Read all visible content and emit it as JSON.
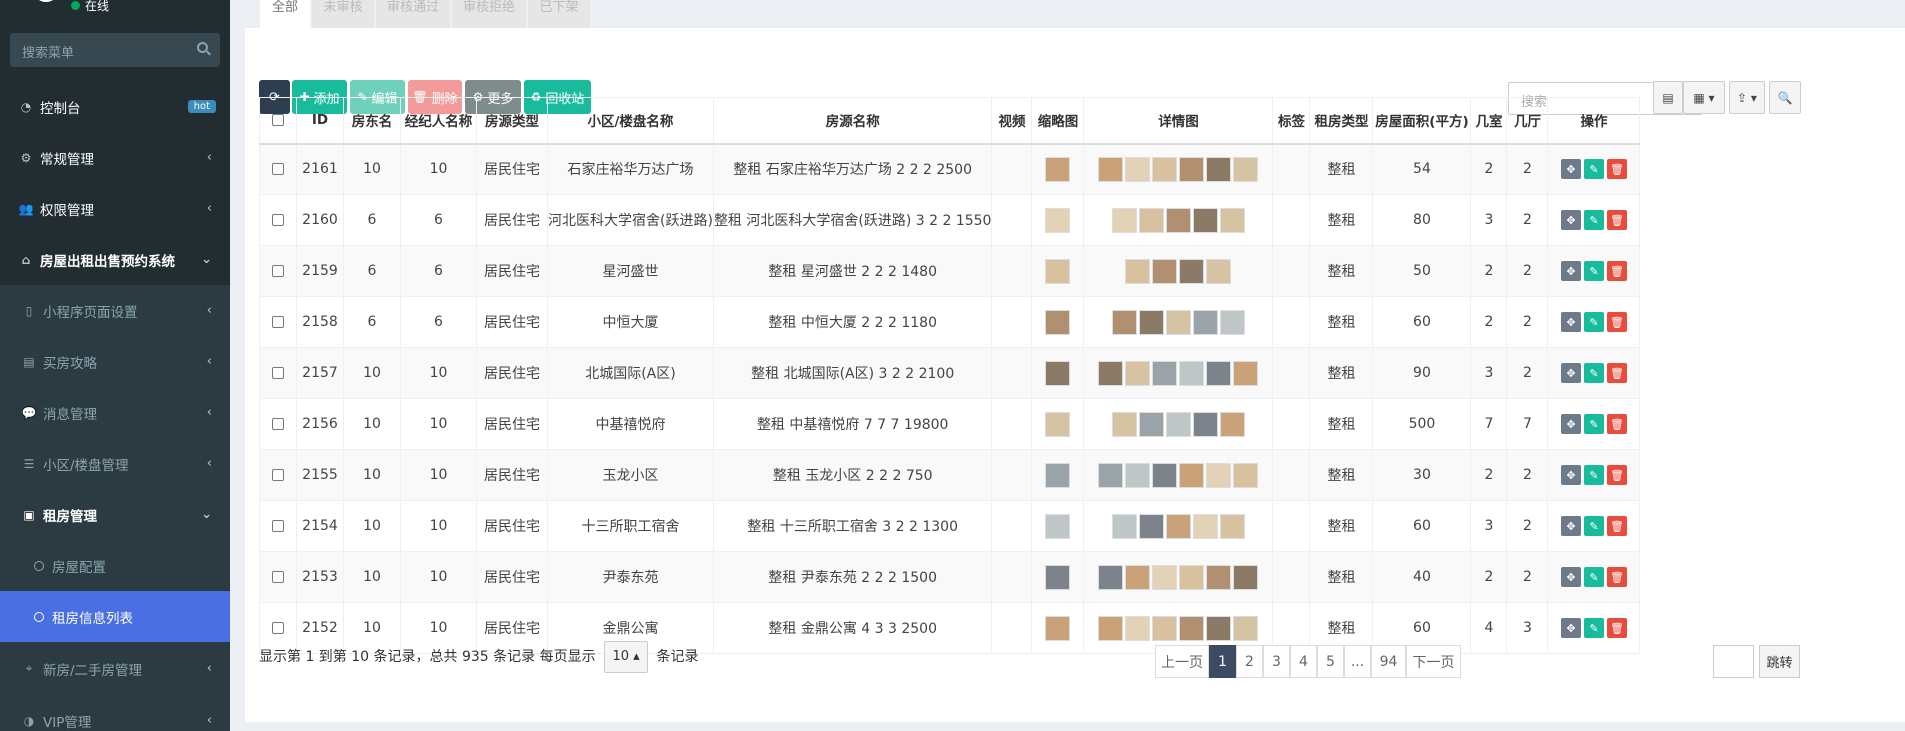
{
  "sidebar": {
    "status": "在线",
    "search_placeholder": "搜索菜单",
    "items": [
      {
        "label": "控制台",
        "badge": "hot"
      },
      {
        "label": "常规管理"
      },
      {
        "label": "权限管理"
      },
      {
        "label": "房屋出租出售预约系统"
      },
      {
        "label": "小程序页面设置"
      },
      {
        "label": "买房攻略"
      },
      {
        "label": "消息管理"
      },
      {
        "label": "小区/楼盘管理"
      },
      {
        "label": "租房管理"
      },
      {
        "label": "房屋配置"
      },
      {
        "label": "租房信息列表"
      },
      {
        "label": "新房/二手房管理"
      },
      {
        "label": "VIP管理"
      }
    ]
  },
  "tabs": [
    "全部",
    "未审核",
    "审核通过",
    "审核拒绝",
    "已下架"
  ],
  "toolbar": {
    "add": "添加",
    "edit": "编辑",
    "delete": "删除",
    "more": "更多",
    "recycle": "回收站",
    "search_placeholder": "搜索"
  },
  "columns": [
    "ID",
    "房东名",
    "经纪人名称",
    "房源类型",
    "小区/楼盘名称",
    "房源名称",
    "视频",
    "缩略图",
    "详情图",
    "标签",
    "租房类型",
    "房屋面积(平方)",
    "几室",
    "几厅",
    "操作"
  ],
  "rows": [
    {
      "id": "2161",
      "owner": "10",
      "agent": "10",
      "type": "居民住宅",
      "community": "石家庄裕华万达广场",
      "name": "整租 石家庄裕华万达广场 2 2 2 2500",
      "rent": "整租",
      "area": "54",
      "rooms": "2",
      "halls": "2",
      "imgs": 6
    },
    {
      "id": "2160",
      "owner": "6",
      "agent": "6",
      "type": "居民住宅",
      "community": "河北医科大学宿舍(跃进路)",
      "name": "整租 河北医科大学宿舍(跃进路) 3 2 2 1550",
      "rent": "整租",
      "area": "80",
      "rooms": "3",
      "halls": "2",
      "imgs": 5
    },
    {
      "id": "2159",
      "owner": "6",
      "agent": "6",
      "type": "居民住宅",
      "community": "星河盛世",
      "name": "整租 星河盛世 2 2 2 1480",
      "rent": "整租",
      "area": "50",
      "rooms": "2",
      "halls": "2",
      "imgs": 4
    },
    {
      "id": "2158",
      "owner": "6",
      "agent": "6",
      "type": "居民住宅",
      "community": "中恒大厦",
      "name": "整租 中恒大厦 2 2 2 1180",
      "rent": "整租",
      "area": "60",
      "rooms": "2",
      "halls": "2",
      "imgs": 5
    },
    {
      "id": "2157",
      "owner": "10",
      "agent": "10",
      "type": "居民住宅",
      "community": "北城国际(A区)",
      "name": "整租 北城国际(A区) 3 2 2 2100",
      "rent": "整租",
      "area": "90",
      "rooms": "3",
      "halls": "2",
      "imgs": 6
    },
    {
      "id": "2156",
      "owner": "10",
      "agent": "10",
      "type": "居民住宅",
      "community": "中基禧悦府",
      "name": "整租 中基禧悦府 7 7 7 19800",
      "rent": "整租",
      "area": "500",
      "rooms": "7",
      "halls": "7",
      "imgs": 5
    },
    {
      "id": "2155",
      "owner": "10",
      "agent": "10",
      "type": "居民住宅",
      "community": "玉龙小区",
      "name": "整租 玉龙小区 2 2 2 750",
      "rent": "整租",
      "area": "30",
      "rooms": "2",
      "halls": "2",
      "imgs": 6
    },
    {
      "id": "2154",
      "owner": "10",
      "agent": "10",
      "type": "居民住宅",
      "community": "十三所职工宿舍",
      "name": "整租 十三所职工宿舍 3 2 2 1300",
      "rent": "整租",
      "area": "60",
      "rooms": "3",
      "halls": "2",
      "imgs": 5
    },
    {
      "id": "2153",
      "owner": "10",
      "agent": "10",
      "type": "居民住宅",
      "community": "尹泰东苑",
      "name": "整租 尹泰东苑 2 2 2 1500",
      "rent": "整租",
      "area": "40",
      "rooms": "2",
      "halls": "2",
      "imgs": 6
    },
    {
      "id": "2152",
      "owner": "10",
      "agent": "10",
      "type": "居民住宅",
      "community": "金鼎公寓",
      "name": "整租 金鼎公寓 4 3 3 2500",
      "rent": "整租",
      "area": "60",
      "rooms": "4",
      "halls": "3",
      "imgs": 6
    }
  ],
  "footer": {
    "summary": "显示第 1 到第 10 条记录，总共 935 条记录 每页显示",
    "page_size": "10",
    "suffix": "条记录"
  },
  "pagination": [
    "上一页",
    "1",
    "2",
    "3",
    "4",
    "5",
    "...",
    "94",
    "下一页"
  ],
  "jump_label": "跳转",
  "colors": {
    "sidebar_bg": "#222d32",
    "active_menu": "#4a6fe3",
    "btn_refresh": "#2c3e50",
    "btn_add": "#18bc9c",
    "btn_edit": "#6fd1bb",
    "btn_delete": "#f39b9b",
    "btn_more": "#7f8c8d",
    "op_drag": "#6c7a89",
    "op_edit": "#18bc9c",
    "op_del": "#e74c3c"
  }
}
